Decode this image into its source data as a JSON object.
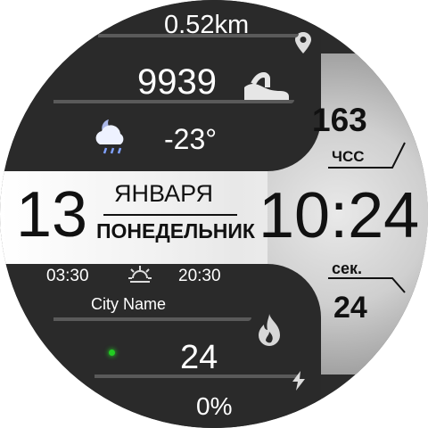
{
  "distance": "0.52km",
  "steps": "9939",
  "weather": {
    "temperature": "-23°"
  },
  "heart_rate": {
    "value": "163",
    "label": "ЧСС"
  },
  "date": {
    "day": "13",
    "month": "ЯНВАРЯ",
    "weekday": "ПОНЕДЕЛЬНИК"
  },
  "time": {
    "display": "10:24"
  },
  "seconds": {
    "label": "сек.",
    "value": "24"
  },
  "sun": {
    "sunrise": "03:30",
    "sunset": "20:30"
  },
  "city": "City Name",
  "calories": "24",
  "battery": "0%",
  "colors": {
    "status_dot": "#22cc22",
    "panel_dark": "#2a2a2a",
    "text_light": "#ffffff"
  },
  "icons": [
    "location-pin-icon",
    "shoe-icon",
    "weather-moon-cloud-icon",
    "sunrise-icon",
    "flame-icon",
    "lightning-icon"
  ]
}
